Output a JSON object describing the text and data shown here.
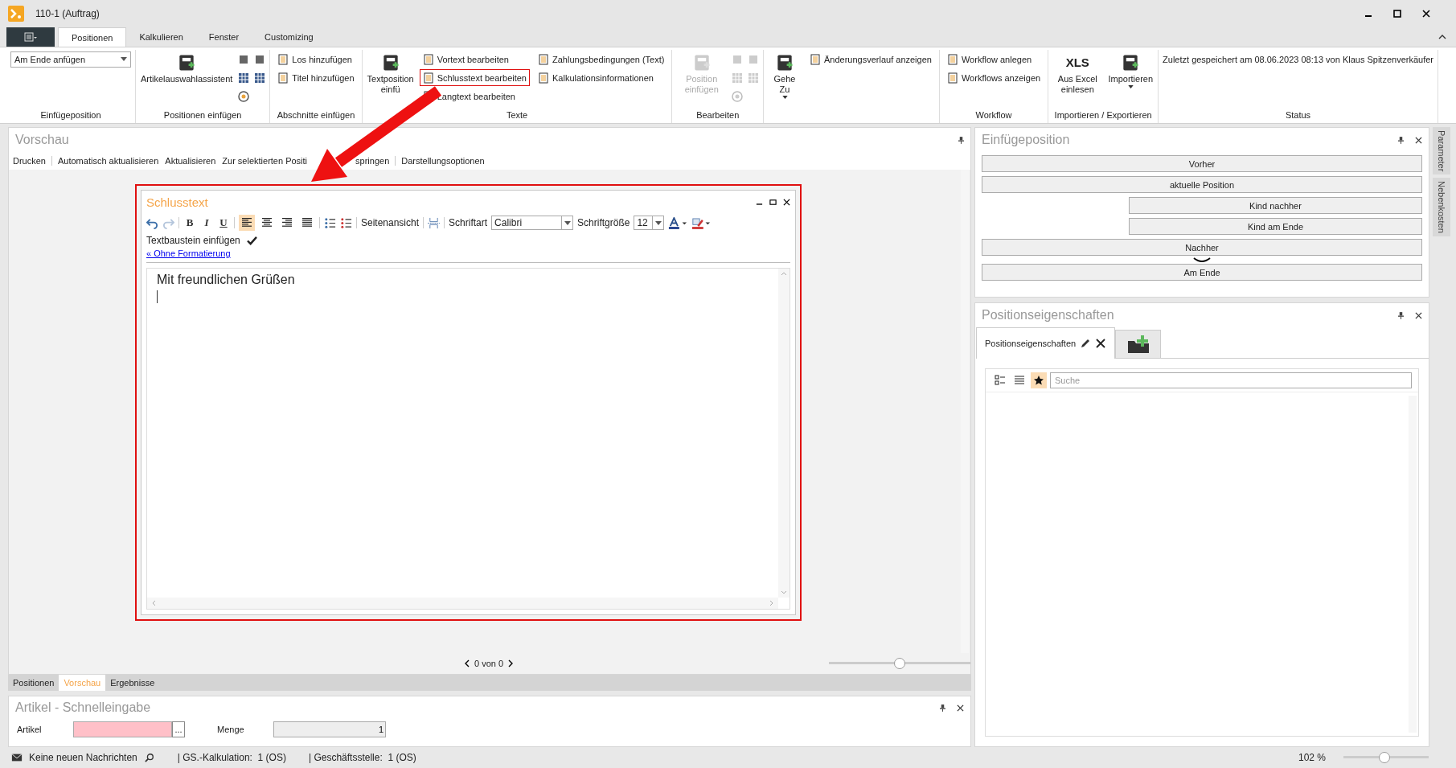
{
  "window": {
    "title": "110-1  (Auftrag)"
  },
  "ribbon_tabs": [
    {
      "label": "Positionen",
      "selected": true
    },
    {
      "label": "Kalkulieren",
      "selected": false
    },
    {
      "label": "Fenster",
      "selected": false
    },
    {
      "label": "Customizing",
      "selected": false
    }
  ],
  "ribbon_groups": [
    {
      "label": "Einfügeposition",
      "items": [
        {
          "kind": "dropdown",
          "value": "Am Ende anfügen"
        }
      ]
    },
    {
      "label": "Positionen einfügen",
      "items": [
        {
          "kind": "large",
          "label": "Artikelauswahlassistent"
        },
        {
          "kind": "icon"
        },
        {
          "kind": "icon"
        },
        {
          "kind": "icon"
        },
        {
          "kind": "icon"
        },
        {
          "kind": "icon"
        }
      ]
    },
    {
      "label": "Abschnitte einfügen",
      "items": [
        {
          "kind": "small",
          "label": "Los hinzufügen"
        },
        {
          "kind": "small",
          "label": "Titel hinzufügen"
        }
      ]
    },
    {
      "label": "Texte",
      "items": [
        {
          "kind": "large",
          "label": "Textposition einfü",
          "annotated": false
        },
        {
          "kind": "small",
          "label": "Vortext bearbeiten",
          "annotated": false
        },
        {
          "kind": "small",
          "label": "Schlusstext bearbeiten",
          "annotated": true
        },
        {
          "kind": "small",
          "label": "Langtext bearbeiten",
          "annotated": false
        },
        {
          "kind": "small",
          "label": "Zahlungsbedingungen (Text)",
          "annotated": false
        },
        {
          "kind": "small",
          "label": "Kalkulationsinformationen",
          "annotated": false
        }
      ]
    },
    {
      "label": "Bearbeiten",
      "items": [
        {
          "kind": "large",
          "label": "Position einfügen",
          "disabled": true
        },
        {
          "kind": "icon",
          "disabled": true
        },
        {
          "kind": "icon",
          "disabled": true
        },
        {
          "kind": "icon",
          "disabled": true
        },
        {
          "kind": "icon",
          "disabled": true
        },
        {
          "kind": "icon",
          "disabled": true
        }
      ]
    },
    {
      "items": [
        {
          "kind": "large-menu",
          "label": "Gehe Zu"
        },
        {
          "kind": "small",
          "label": "Änderungsverlauf anzeigen"
        }
      ]
    },
    {
      "label": "Workflow",
      "items": [
        {
          "kind": "small",
          "label": "Workflow anlegen"
        },
        {
          "kind": "small",
          "label": "Workflows anzeigen"
        }
      ]
    },
    {
      "label": "Importieren / Exportieren",
      "items": [
        {
          "kind": "large",
          "label": "Aus Excel einlesen",
          "icon_text": "XLS"
        },
        {
          "kind": "large-menu",
          "label": "Importieren"
        }
      ]
    },
    {
      "label": "Status",
      "items": [
        {
          "kind": "text",
          "label": "Zuletzt gespeichert am 08.06.2023 08:13 von Klaus Spitzenverkäufer"
        }
      ]
    }
  ],
  "preview": {
    "title": "Vorschau",
    "toolbar": [
      {
        "label": "Drucken",
        "separator_before": false
      },
      {
        "label": "Automatisch aktualisieren",
        "separator_before": true
      },
      {
        "label": "Aktualisieren",
        "separator_before": false
      },
      {
        "label": "Zur selektierten Positi",
        "separator_before": false
      },
      {
        "label": "springen",
        "separator_before": false
      },
      {
        "label": "Darstellungsoptionen",
        "separator_before": true
      }
    ],
    "editor": {
      "title": "Schlusstext",
      "toolbar": [
        {
          "kind": "undo"
        },
        {
          "kind": "redo"
        },
        {
          "kind": "sep"
        },
        {
          "kind": "format",
          "label": "B"
        },
        {
          "kind": "format",
          "label": "I"
        },
        {
          "kind": "format",
          "label": "U"
        },
        {
          "kind": "sep"
        },
        {
          "kind": "align",
          "selected": true
        },
        {
          "kind": "align",
          "selected": false
        },
        {
          "kind": "align",
          "selected": false
        },
        {
          "kind": "align",
          "selected": false
        },
        {
          "kind": "sep"
        },
        {
          "kind": "bullets"
        },
        {
          "kind": "numbers"
        },
        {
          "kind": "sep"
        },
        {
          "kind": "label",
          "label": "Seitenansicht"
        },
        {
          "kind": "sep"
        },
        {
          "kind": "pagebreak"
        },
        {
          "kind": "sep"
        },
        {
          "kind": "label",
          "label": "Schriftart"
        },
        {
          "kind": "combo",
          "value": "Calibri"
        },
        {
          "kind": "label",
          "label": "Schriftgröße"
        },
        {
          "kind": "combo",
          "value": "12"
        },
        {
          "kind": "fontcolor"
        },
        {
          "kind": "highlight"
        }
      ],
      "insert_block": "Textbaustein einfügen",
      "link": "« Ohne Formatierung",
      "content": "Mit freundlichen Grüßen"
    },
    "pager": "0 von 0",
    "zoom_slider": {
      "level": 0.5
    }
  },
  "bottom_tabs": [
    {
      "label": "Positionen",
      "selected": false
    },
    {
      "label": "Vorschau",
      "selected": true
    },
    {
      "label": "Ergebnisse",
      "selected": false
    }
  ],
  "quick_entry": {
    "title": "Artikel - Schnelleingabe",
    "fields": [
      {
        "label": "Artikel",
        "invalid": true,
        "browse": "..."
      },
      {
        "label": "Menge",
        "invalid": false,
        "value": "1"
      }
    ]
  },
  "insert_position": {
    "title": "Einfügeposition",
    "buttons": [
      {
        "label": "Vorher",
        "indented": false
      },
      {
        "label": "aktuelle Position",
        "indented": false
      },
      {
        "label": "Kind nachher",
        "indented": true
      },
      {
        "label": "Kind am Ende",
        "indented": true
      },
      {
        "label": "Nachher",
        "indented": false
      },
      {
        "label": "Am Ende",
        "indented": false
      }
    ]
  },
  "properties": {
    "title": "Positionseigenschaften",
    "tabs": [
      {
        "label": "Positionseigenschaften",
        "selected": true
      }
    ],
    "view_buttons": [
      {
        "selected": false
      },
      {
        "selected": false
      },
      {
        "selected": true
      }
    ],
    "search_placeholder": "Suche"
  },
  "side_tabs": [
    {
      "label": "Parameter"
    },
    {
      "label": "Nebenkosten"
    }
  ],
  "status_bar": {
    "messages": "Keine neuen Nachrichten",
    "items": [
      "| GS.-Kalkulation:  1 (OS)",
      "| Geschäftsstelle:  1 (OS)"
    ],
    "zoom": "102 %",
    "zoom_slider": {
      "level": 0.48
    }
  }
}
